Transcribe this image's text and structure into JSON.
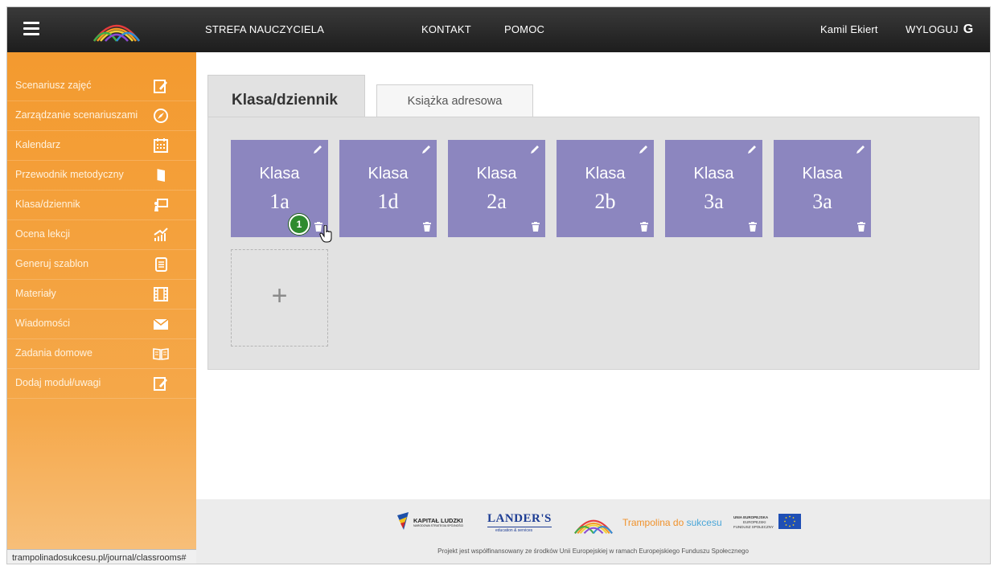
{
  "topbar": {
    "menu_icon": "hamburger-icon",
    "logo_icon": "rainbow-arches-logo",
    "zone_label": "STREFA NAUCZYCIELA",
    "contact_label": "KONTAKT",
    "help_label": "POMOC",
    "user_name": "Kamil Ekiert",
    "logout_label": "WYLOGUJ",
    "logout_icon": "logout-arrow-icon"
  },
  "sidebar": {
    "items": [
      {
        "label": "Scenariusz zajęć",
        "icon": "edit-note-icon"
      },
      {
        "label": "Zarządzanie scenariuszami",
        "icon": "compass-icon"
      },
      {
        "label": "Kalendarz",
        "icon": "calendar-icon"
      },
      {
        "label": "Przewodnik metodyczny",
        "icon": "book-icon"
      },
      {
        "label": "Klasa/dziennik",
        "icon": "chalkboard-icon"
      },
      {
        "label": "Ocena lekcji",
        "icon": "chart-rising-icon"
      },
      {
        "label": "Generuj szablon",
        "icon": "document-icon"
      },
      {
        "label": "Materiały",
        "icon": "film-icon"
      },
      {
        "label": "Wiadomości",
        "icon": "envelope-icon"
      },
      {
        "label": "Zadania domowe",
        "icon": "open-book-icon"
      },
      {
        "label": "Dodaj moduł/uwagi",
        "icon": "add-note-icon"
      }
    ]
  },
  "status_url": "trampolinadosukcesu.pl/journal/classrooms#",
  "tabs": {
    "active": "Klasa/dziennik",
    "inactive": "Książka adresowa"
  },
  "classes": [
    {
      "title": "Klasa",
      "name": "1a"
    },
    {
      "title": "Klasa",
      "name": "1d"
    },
    {
      "title": "Klasa",
      "name": "2a"
    },
    {
      "title": "Klasa",
      "name": "2b"
    },
    {
      "title": "Klasa",
      "name": "3a"
    },
    {
      "title": "Klasa",
      "name": "3a"
    }
  ],
  "step_badge": "1",
  "add_tile_symbol": "+",
  "footer": {
    "kapital_ludzki": "KAPITAŁ LUDZKI",
    "kapital_sub": "NARODOWA STRATEGIA SPÓJNOŚCI",
    "landers": "LANDER'S",
    "landers_sub": "education & services",
    "trampolina_main": "Trampolina do",
    "trampolina_accent": "sukcesu",
    "ue_line1": "UNIA EUROPEJSKA",
    "ue_line2": "EUROPEJSKI",
    "ue_line3": "FUNDUSZ SPOŁECZNY",
    "funding_text": "Projekt jest współfinansowany ze środków Unii Europejskiej w ramach Europejskiego Funduszu Społecznego"
  },
  "colors": {
    "topbar": "#2a2a2a",
    "sidebar": "#f39a2f",
    "card": "#8c86bf",
    "badge": "#2e8b2e",
    "panel": "#e2e2e2"
  }
}
